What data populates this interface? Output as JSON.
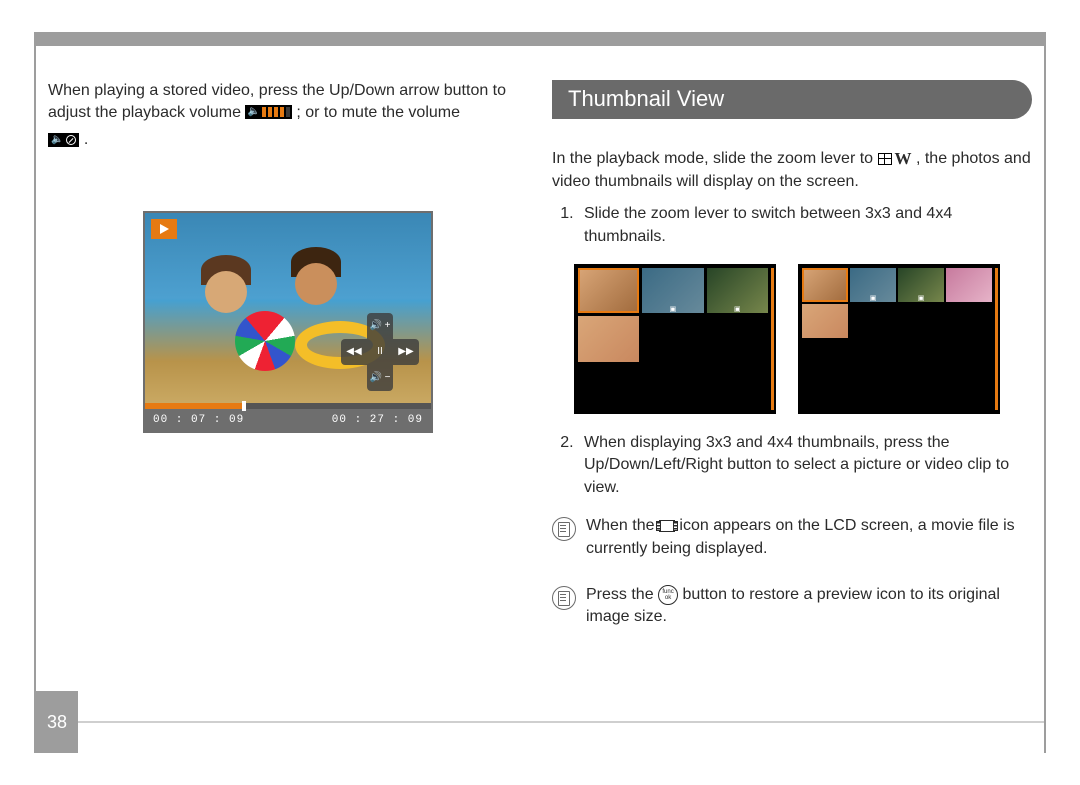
{
  "page_number": "38",
  "left": {
    "para_a": "When playing a stored video, press the Up/Down arrow button to adjust the playback volume ",
    "para_b": " ; or to mute the volume ",
    "para_end": " .",
    "dpad_up": "🔊 +",
    "dpad_down": "🔊 −",
    "dpad_left": "◀◀",
    "dpad_right": "▶▶",
    "dpad_mid": "II",
    "time_elapsed": "00 : 07 : 09",
    "time_total": "00 : 27 : 09"
  },
  "right": {
    "title": "Thumbnail View",
    "intro_a": "In the playback mode, slide the zoom lever to ",
    "intro_b": " , the photos and video thumbnails will display on the screen.",
    "step1": "Slide the zoom lever to switch between 3x3 and 4x4 thumbnails.",
    "step2": "When displaying 3x3 and 4x4 thumbnails, press the Up/Down/Left/Right button to select a picture or video clip to view.",
    "note1_a": "When the ",
    "note1_b": " icon appears on the LCD screen, a movie file is currently being displayed.",
    "note2_a": "Press the ",
    "note2_b": " button to restore a preview icon to its original image size.",
    "func_top": "func",
    "func_bot": "ok",
    "w_label": "W"
  }
}
